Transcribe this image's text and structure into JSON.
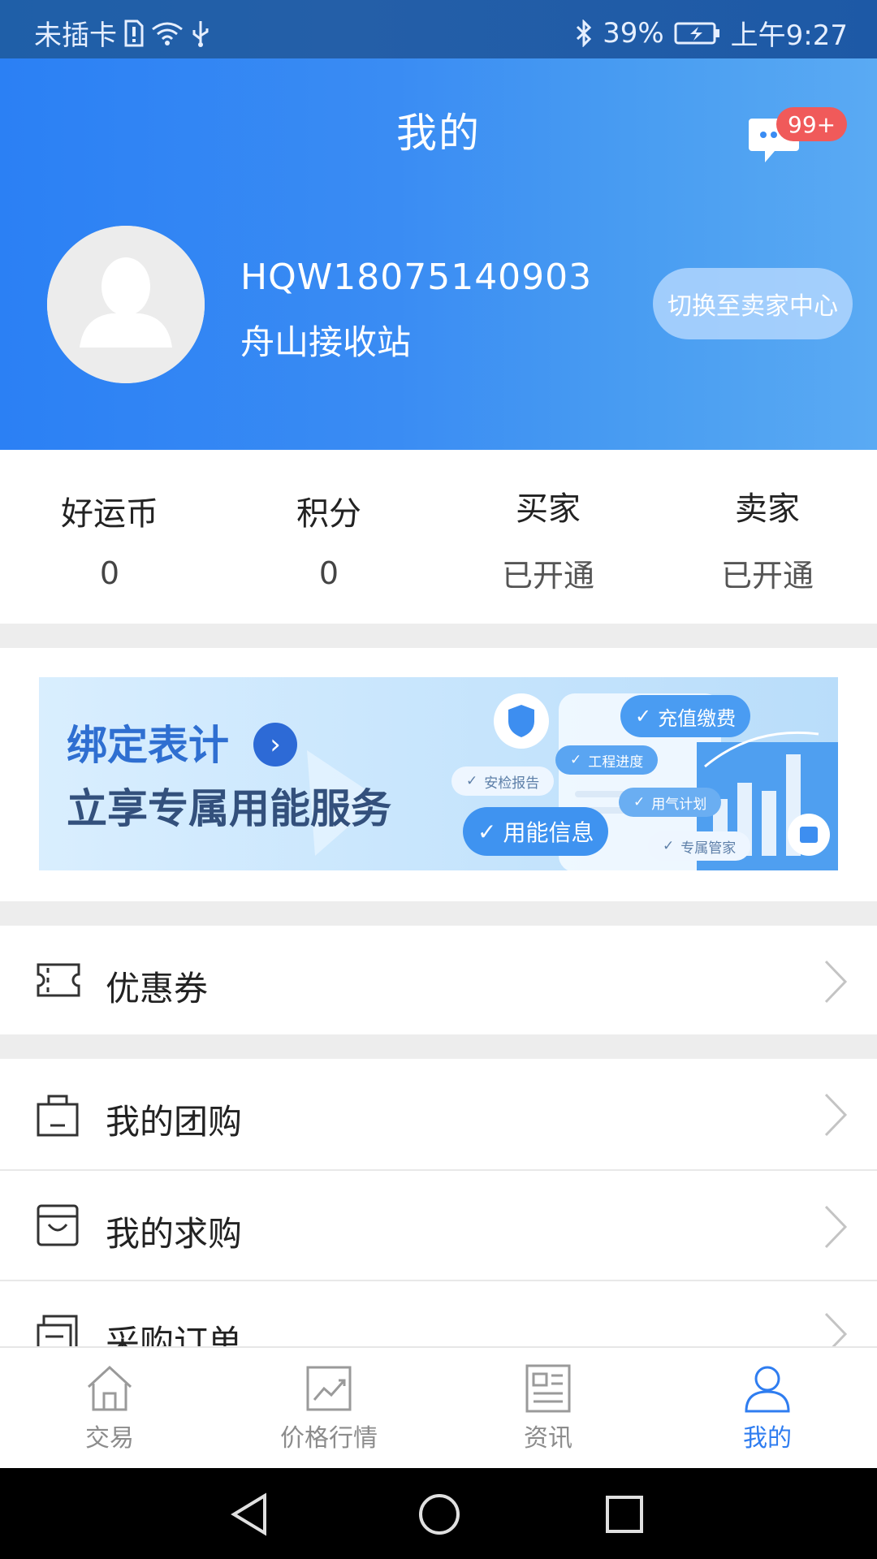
{
  "status_bar": {
    "carrier": "未插卡",
    "battery": "39%",
    "time": "上午9:27"
  },
  "header": {
    "title": "我的",
    "message_badge": "99+",
    "user_id": "HQW18075140903",
    "station": "舟山接收站",
    "switch_button": "切换至卖家中心"
  },
  "stats": [
    {
      "label": "好运币",
      "value": "0"
    },
    {
      "label": "积分",
      "value": "0"
    },
    {
      "label": "买家",
      "value": "已开通"
    },
    {
      "label": "卖家",
      "value": "已开通"
    }
  ],
  "banner": {
    "line1": "绑定表计",
    "line2": "立享专属用能服务",
    "tags": [
      "充值缴费",
      "工程进度",
      "安检报告",
      "用气计划",
      "用能信息",
      "专属管家"
    ]
  },
  "menu": [
    {
      "label": "优惠券",
      "icon": "coupon-icon"
    },
    {
      "label": "我的团购",
      "icon": "bag-icon"
    },
    {
      "label": "我的求购",
      "icon": "box-icon"
    },
    {
      "label": "采购订单",
      "icon": "order-icon"
    }
  ],
  "tabs": [
    {
      "label": "交易",
      "icon": "home-icon"
    },
    {
      "label": "价格行情",
      "icon": "chart-icon"
    },
    {
      "label": "资讯",
      "icon": "news-icon"
    },
    {
      "label": "我的",
      "icon": "user-icon",
      "active": true
    }
  ],
  "colors": {
    "primary": "#2f7df0",
    "badge": "#f05a5a",
    "tab_inactive": "#8c8c8c"
  }
}
